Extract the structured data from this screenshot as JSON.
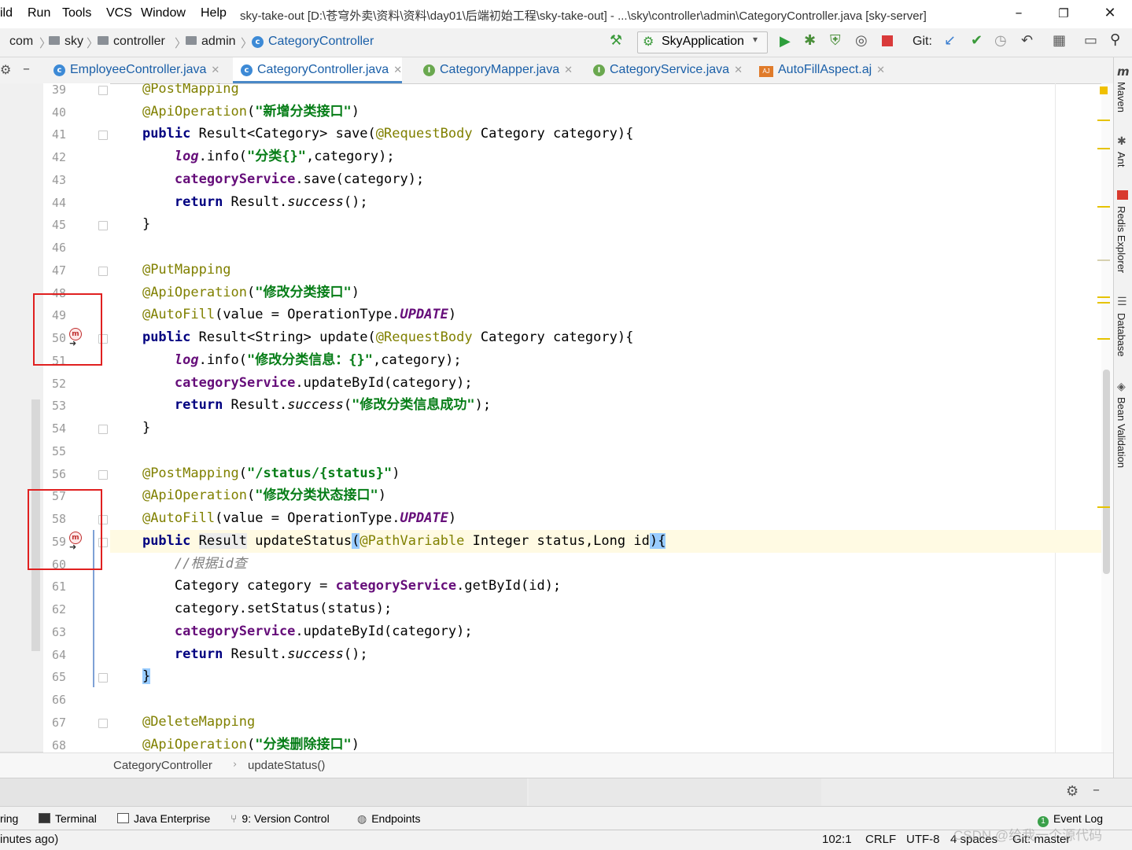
{
  "menu": {
    "items": [
      "ild",
      "Run",
      "Tools",
      "VCS",
      "Window",
      "Help"
    ],
    "window_title": "sky-take-out [D:\\苍穹外卖\\资料\\资料\\day01\\后端初始工程\\sky-take-out] - ...\\sky\\controller\\admin\\CategoryController.java [sky-server]"
  },
  "nav": {
    "crumbs": [
      "com",
      "sky",
      "controller",
      "admin",
      "CategoryController"
    ],
    "run_config": "SkyApplication",
    "git_label": "Git:"
  },
  "tabs": [
    {
      "label": "EmployeeController.java",
      "icon": "C"
    },
    {
      "label": "CategoryController.java",
      "icon": "C"
    },
    {
      "label": "CategoryMapper.java",
      "icon": "I"
    },
    {
      "label": "CategoryService.java",
      "icon": "I"
    },
    {
      "label": "AutoFillAspect.aj",
      "icon": "AJ"
    }
  ],
  "editor": {
    "line_numbers": [
      "39",
      "40",
      "41",
      "42",
      "43",
      "44",
      "45",
      "46",
      "47",
      "48",
      "49",
      "50",
      "51",
      "52",
      "53",
      "54",
      "55",
      "56",
      "57",
      "58",
      "59",
      "60",
      "61",
      "62",
      "63",
      "64",
      "65",
      "66",
      "67",
      "68"
    ],
    "strings": {
      "s40": "\"新增分类接口\"",
      "s42": "\"分类{}\"",
      "s48": "\"修改分类接口\"",
      "s51": "\"修改分类信息：{}\"",
      "s53": "\"修改分类信息成功\"",
      "s56": "\"/status/{status}\"",
      "s57": "\"修改分类状态接口\"",
      "s60": "//根据id查",
      "s68": "\"分类删除接口\""
    }
  },
  "right_tools": [
    "Maven",
    "Ant",
    "Redis Explorer",
    "Database",
    "Bean Validation"
  ],
  "code_breadcrumb": {
    "cls": "CategoryController",
    "method": "updateStatus()"
  },
  "tool_windows": [
    "ring",
    "Terminal",
    "Java Enterprise",
    "9: Version Control",
    "Endpoints",
    "Event Log"
  ],
  "status": {
    "left": "inutes ago)",
    "position": "102:1",
    "line_sep": "CRLF",
    "encoding": "UTF-8",
    "indent": "4 spaces",
    "branch": "Git: master",
    "watermark": "CSDN @给我一个源代码"
  }
}
